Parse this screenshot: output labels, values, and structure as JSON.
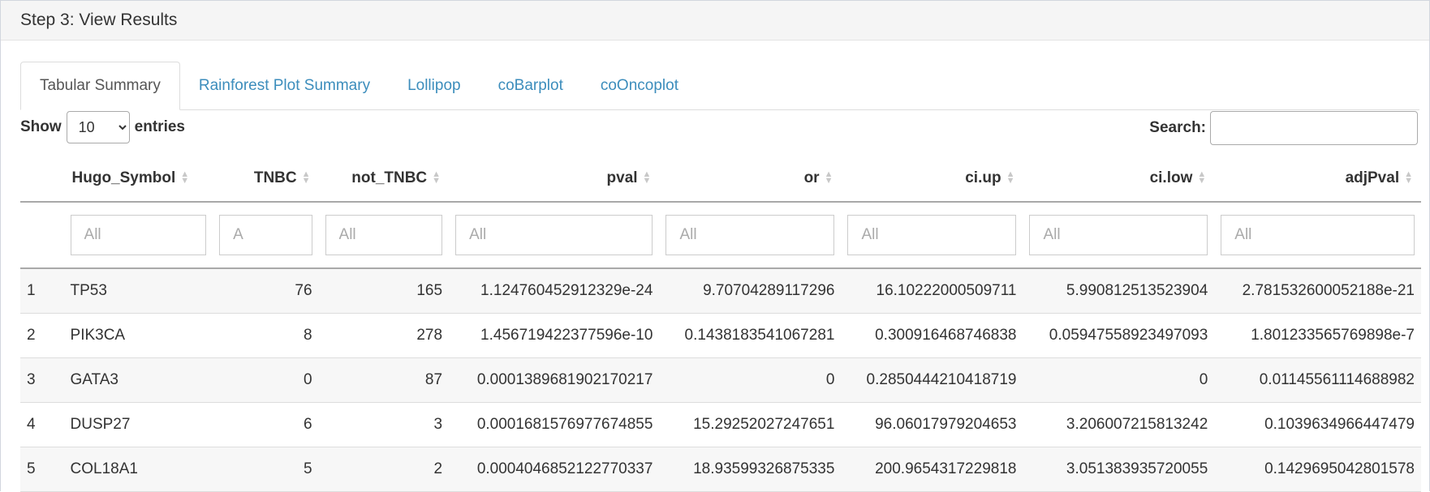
{
  "header": {
    "title": "Step 3: View Results"
  },
  "tabs": [
    {
      "label": "Tabular Summary",
      "active": true
    },
    {
      "label": "Rainforest Plot Summary",
      "active": false
    },
    {
      "label": "Lollipop",
      "active": false
    },
    {
      "label": "coBarplot",
      "active": false
    },
    {
      "label": "coOncoplot",
      "active": false
    }
  ],
  "length": {
    "show_label": "Show",
    "value": "10",
    "options": [
      "10"
    ],
    "entries_label": "entries"
  },
  "search": {
    "label": "Search:",
    "value": ""
  },
  "table": {
    "columns": [
      "",
      "Hugo_Symbol",
      "TNBC",
      "not_TNBC",
      "pval",
      "or",
      "ci.up",
      "ci.low",
      "adjPval"
    ],
    "filters": [
      "",
      "All",
      "A",
      "All",
      "All",
      "All",
      "All",
      "All",
      "All"
    ],
    "rows": [
      [
        "1",
        "TP53",
        "76",
        "165",
        "1.124760452912329e-24",
        "9.70704289117296",
        "16.10222000509711",
        "5.990812513523904",
        "2.781532600052188e-21"
      ],
      [
        "2",
        "PIK3CA",
        "8",
        "278",
        "1.456719422377596e-10",
        "0.1438183541067281",
        "0.300916468746838",
        "0.05947558923497093",
        "1.801233565769898e-7"
      ],
      [
        "3",
        "GATA3",
        "0",
        "87",
        "0.0001389681902170217",
        "0",
        "0.2850444210418719",
        "0",
        "0.01145561114688982"
      ],
      [
        "4",
        "DUSP27",
        "6",
        "3",
        "0.0001681576977674855",
        "15.29252027247651",
        "96.06017979204653",
        "3.206007215813242",
        "0.1039634966447479"
      ],
      [
        "5",
        "COL18A1",
        "5",
        "2",
        "0.0004046852122770337",
        "18.93599326875335",
        "200.9654317229818",
        "3.051383935720055",
        "0.1429695042801578"
      ]
    ]
  }
}
